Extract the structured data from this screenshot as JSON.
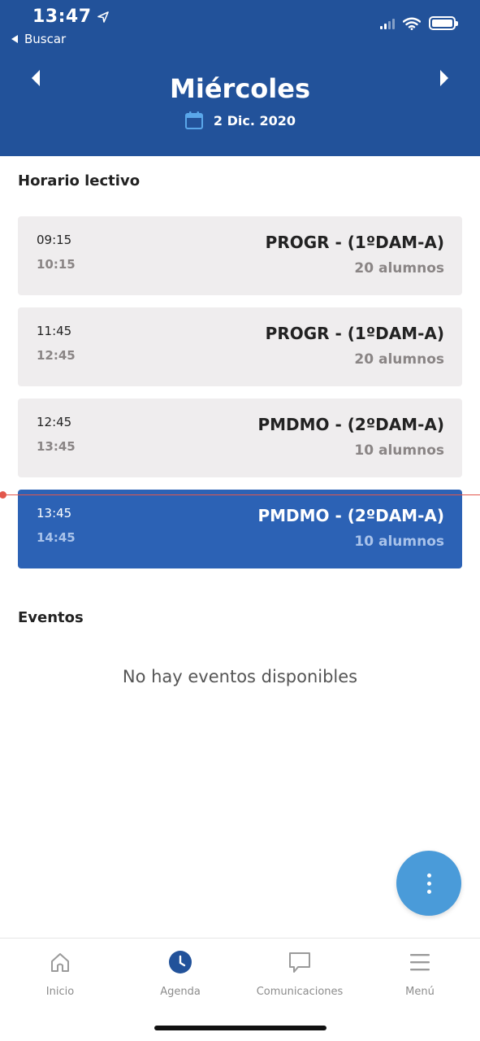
{
  "status_bar": {
    "time": "13:47",
    "back_label": "Buscar",
    "icons": [
      "location-arrow-icon",
      "cellular-signal-icon",
      "wifi-icon",
      "battery-icon"
    ]
  },
  "header": {
    "day": "Miércoles",
    "date": "2 Dic. 2020",
    "prev_icon": "triangle-left-icon",
    "next_icon": "triangle-right-icon",
    "calendar_icon": "calendar-icon",
    "background_color": "#22529a"
  },
  "schedule": {
    "title": "Horario lectivo",
    "classes": [
      {
        "start": "09:15",
        "end": "10:15",
        "subject": "PROGR - (1ºDAM-A)",
        "students": "20 alumnos"
      },
      {
        "start": "11:45",
        "end": "12:45",
        "subject": "PROGR - (1ºDAM-A)",
        "students": "20 alumnos"
      },
      {
        "start": "12:45",
        "end": "13:45",
        "subject": "PMDMO - (2ºDAM-A)",
        "students": "10 alumnos"
      },
      {
        "start": "13:45",
        "end": "14:45",
        "subject": "PMDMO - (2ºDAM-A)",
        "students": "10 alumnos",
        "active": true
      }
    ],
    "active_color": "#2c62b5",
    "now_line_color": "#e2574c"
  },
  "events": {
    "title": "Eventos",
    "empty_message": "No hay eventos disponibles"
  },
  "fab": {
    "icon": "more-vertical-icon",
    "color": "#4a9bd9"
  },
  "tabbar": {
    "tabs": [
      {
        "label": "Inicio",
        "icon": "home-icon"
      },
      {
        "label": "Agenda",
        "icon": "clock-icon",
        "selected": true
      },
      {
        "label": "Comunicaciones",
        "icon": "chat-bubble-icon"
      },
      {
        "label": "Menú",
        "icon": "hamburger-menu-icon"
      }
    ]
  }
}
